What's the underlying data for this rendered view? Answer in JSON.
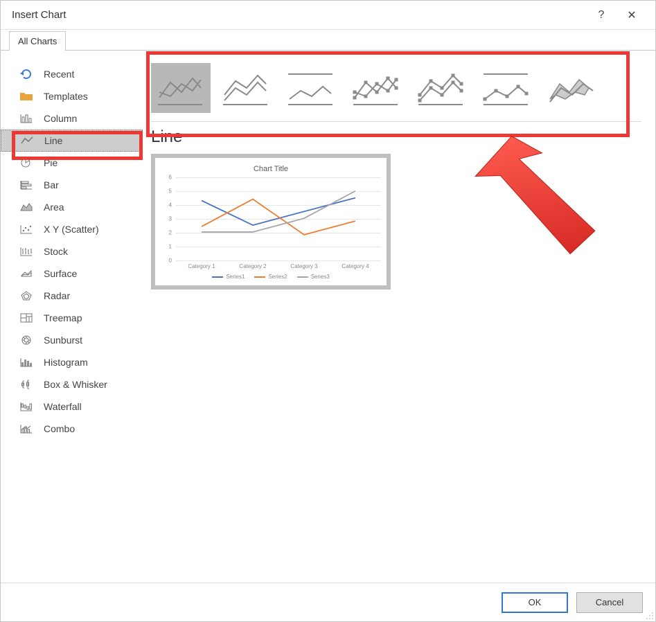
{
  "dialog": {
    "title": "Insert Chart",
    "help_tooltip": "?",
    "close_tooltip": "✕"
  },
  "tabs": {
    "all_charts": "All Charts"
  },
  "sidebar": {
    "items": [
      {
        "label": "Recent"
      },
      {
        "label": "Templates"
      },
      {
        "label": "Column"
      },
      {
        "label": "Line"
      },
      {
        "label": "Pie"
      },
      {
        "label": "Bar"
      },
      {
        "label": "Area"
      },
      {
        "label": "X Y (Scatter)"
      },
      {
        "label": "Stock"
      },
      {
        "label": "Surface"
      },
      {
        "label": "Radar"
      },
      {
        "label": "Treemap"
      },
      {
        "label": "Sunburst"
      },
      {
        "label": "Histogram"
      },
      {
        "label": "Box & Whisker"
      },
      {
        "label": "Waterfall"
      },
      {
        "label": "Combo"
      }
    ],
    "selected_index": 3
  },
  "content": {
    "type_heading": "Line",
    "subtype_selected_index": 0,
    "subtypes": [
      {
        "name": "Line"
      },
      {
        "name": "Stacked Line"
      },
      {
        "name": "100% Stacked Line"
      },
      {
        "name": "Line with Markers"
      },
      {
        "name": "Stacked Line with Markers"
      },
      {
        "name": "100% Stacked Line with Markers"
      },
      {
        "name": "3-D Line"
      }
    ],
    "preview": {
      "chart_title": "Chart Title",
      "y_ticks": [
        "0",
        "1",
        "2",
        "3",
        "4",
        "5",
        "6"
      ],
      "x_categories": [
        "Category 1",
        "Category 2",
        "Category 3",
        "Category 4"
      ],
      "legend": [
        "Series1",
        "Series2",
        "Series3"
      ]
    }
  },
  "buttons": {
    "ok": "OK",
    "cancel": "Cancel"
  },
  "chart_data": {
    "type": "line",
    "title": "Chart Title",
    "xlabel": "",
    "ylabel": "",
    "ylim": [
      0,
      6
    ],
    "categories": [
      "Category 1",
      "Category 2",
      "Category 3",
      "Category 4"
    ],
    "series": [
      {
        "name": "Series1",
        "color": "#4472C4",
        "values": [
          4.3,
          2.5,
          3.5,
          4.5
        ]
      },
      {
        "name": "Series2",
        "color": "#ED7D31",
        "values": [
          2.4,
          4.4,
          1.8,
          2.8
        ]
      },
      {
        "name": "Series3",
        "color": "#A5A5A5",
        "values": [
          2.0,
          2.0,
          3.0,
          5.0
        ]
      }
    ]
  },
  "colors": {
    "annotation": "#ED3833",
    "series1": "#4472C4",
    "series2": "#ED7D31",
    "series3": "#A5A5A5"
  }
}
